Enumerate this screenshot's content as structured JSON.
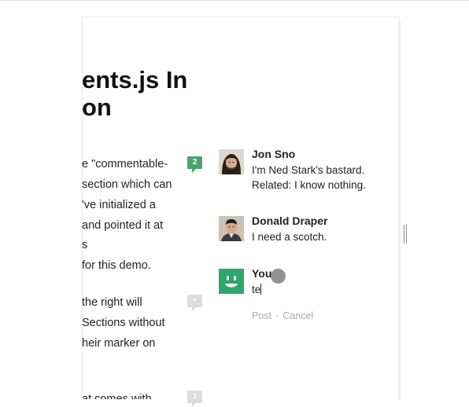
{
  "article": {
    "title_lines": [
      "ents.js In",
      "on"
    ],
    "paragraph1": [
      "e \"commentable-",
      "section which can",
      "'ve initialized a",
      " and pointed it at",
      "s",
      " for this demo."
    ],
    "paragraph2": [
      " the right will",
      "Sections without",
      "heir marker on"
    ],
    "paragraph3": [
      "at comes with"
    ]
  },
  "markers": [
    {
      "label": "2",
      "color": "#49a36b"
    },
    {
      "label": "+",
      "color": "#dcdcdc"
    },
    {
      "label": "1",
      "color": "#dcdcdc"
    }
  ],
  "comments": [
    {
      "author": "Jon Sno",
      "lines": [
        "I'm Ned Stark's bastard.",
        "Related: I know nothing."
      ]
    },
    {
      "author": "Donald Draper",
      "lines": [
        "I need a scotch."
      ]
    }
  ],
  "new_comment": {
    "author": "You",
    "value": "te",
    "post_label": "Post",
    "separator": "·",
    "cancel_label": "Cancel"
  }
}
